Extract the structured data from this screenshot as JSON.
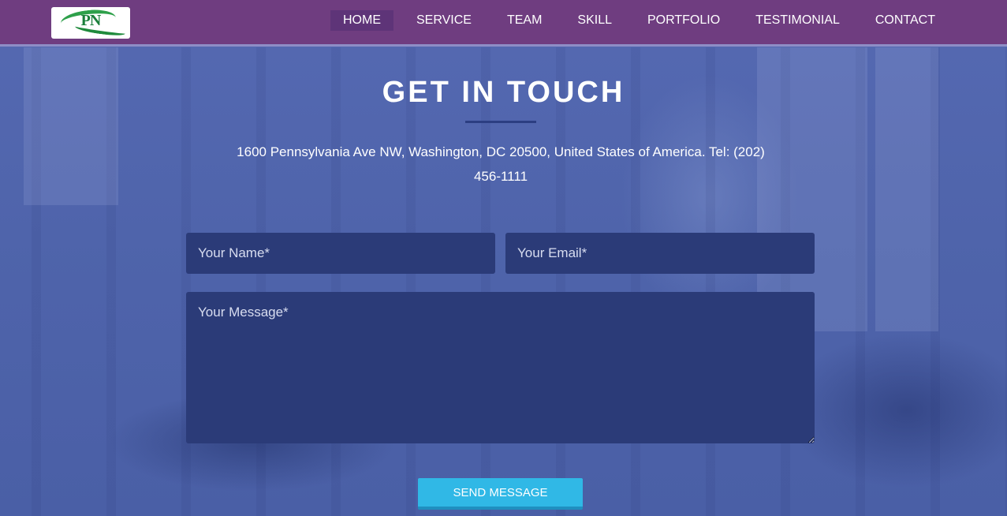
{
  "header": {
    "logo_text": "PN",
    "nav": [
      {
        "label": "HOME",
        "active": true
      },
      {
        "label": "SERVICE",
        "active": false
      },
      {
        "label": "TEAM",
        "active": false
      },
      {
        "label": "SKILL",
        "active": false
      },
      {
        "label": "PORTFOLIO",
        "active": false
      },
      {
        "label": "TESTIMONIAL",
        "active": false
      },
      {
        "label": "CONTACT",
        "active": false
      }
    ]
  },
  "contact": {
    "title": "GET IN TOUCH",
    "address": "1600 Pennsylvania Ave NW, Washington, DC 20500, United States of America. Tel: (202) 456-1111",
    "form": {
      "name_placeholder": "Your Name*",
      "name_value": "",
      "email_placeholder": "Your Email*",
      "email_value": "",
      "message_placeholder": "Your Message*",
      "message_value": "",
      "send_label": "SEND MESSAGE"
    }
  },
  "colors": {
    "navbar": "#6f3d80",
    "overlay": "#4f64ab",
    "field": "#2b3b78",
    "button": "#30b8e6",
    "logo_green": "#1b7f3b"
  }
}
